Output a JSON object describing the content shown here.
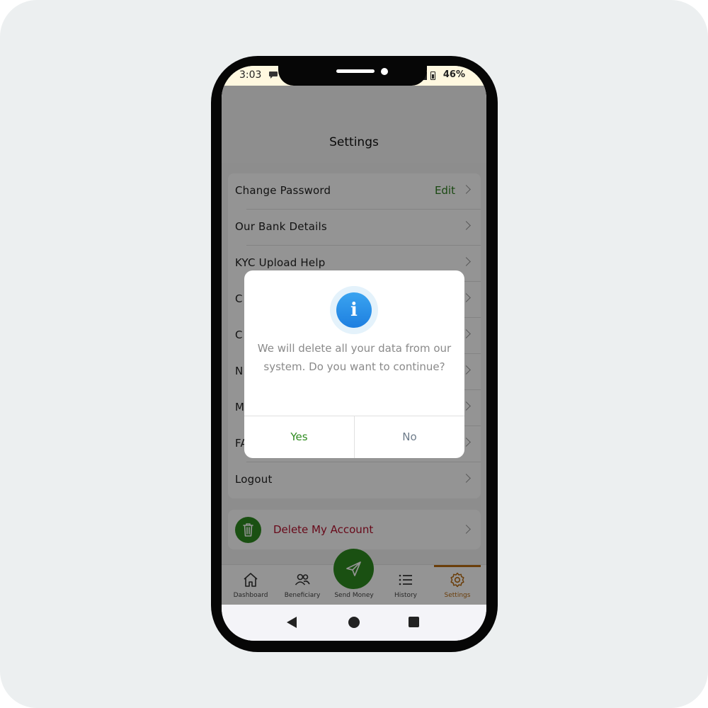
{
  "status_bar": {
    "time": "3:03",
    "battery": "46%"
  },
  "header": {
    "title": "Settings"
  },
  "settings_rows": [
    {
      "label": "Change Password",
      "action": "Edit"
    },
    {
      "label": "Our Bank Details"
    },
    {
      "label": "KYC Upload Help"
    },
    {
      "label": "C"
    },
    {
      "label": "C"
    },
    {
      "label": "N"
    },
    {
      "label": "M"
    },
    {
      "label": "FA"
    },
    {
      "label": "Logout"
    }
  ],
  "delete_account": {
    "label": "Delete My Account"
  },
  "bottom_nav": {
    "items": [
      {
        "label": "Dashboard",
        "icon": "home-icon"
      },
      {
        "label": "Beneficiary",
        "icon": "users-icon"
      },
      {
        "label": "Send Money",
        "icon": "send-icon"
      },
      {
        "label": "History",
        "icon": "list-icon"
      },
      {
        "label": "Settings",
        "icon": "gear-icon",
        "active": true
      }
    ]
  },
  "dialog": {
    "message": "We will delete all your data from our system. Do you want to continue?",
    "yes_label": "Yes",
    "no_label": "No",
    "icon": "info-icon"
  },
  "colors": {
    "accent_green": "#2e8b1f",
    "active_orange": "#b86b12",
    "danger_red": "#b3122e"
  }
}
